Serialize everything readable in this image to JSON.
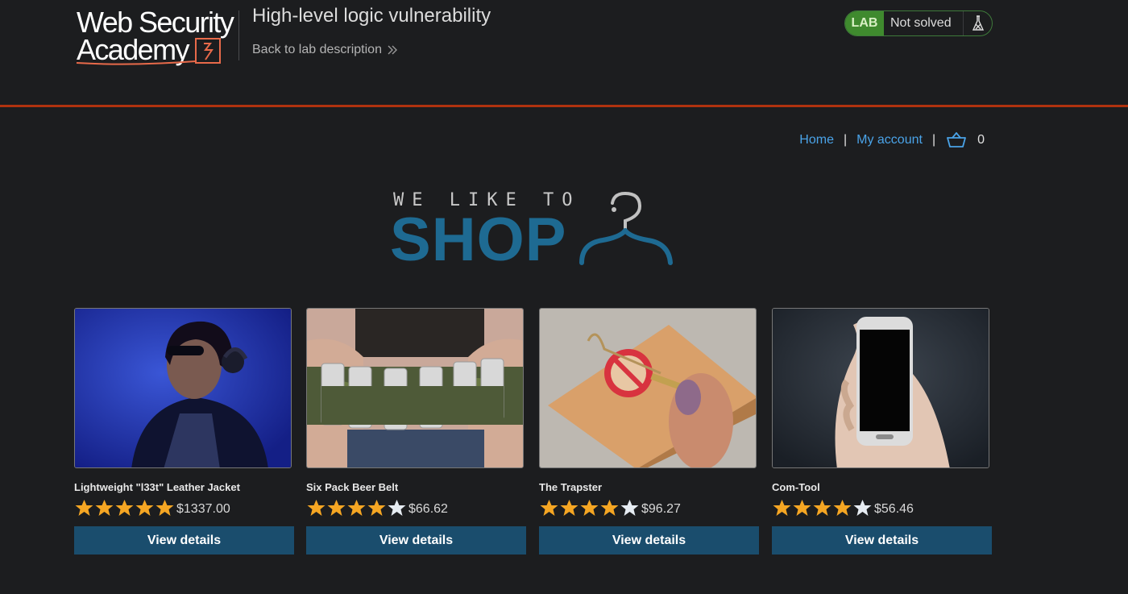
{
  "header": {
    "logo_line1": "Web Security",
    "logo_line2": "Academy",
    "lab_title": "High-level logic vulnerability",
    "back_link": "Back to lab description",
    "lab_badge": "LAB",
    "lab_status": "Not solved"
  },
  "nav": {
    "home": "Home",
    "account": "My account",
    "separator": "|",
    "cart_count": "0"
  },
  "banner": {
    "tagline": "WE LIKE TO",
    "headline": "SHOP"
  },
  "products": [
    {
      "name": "Lightweight \"l33t\" Leather Jacket",
      "rating": 5,
      "price": "$1337.00",
      "button": "View details"
    },
    {
      "name": "Six Pack Beer Belt",
      "rating": 4,
      "price": "$66.62",
      "button": "View details"
    },
    {
      "name": "The Trapster",
      "rating": 4,
      "price": "$96.27",
      "button": "View details"
    },
    {
      "name": "Com-Tool",
      "rating": 4,
      "price": "$56.46",
      "button": "View details"
    }
  ],
  "colors": {
    "background": "#1c1d1f",
    "accent_orange": "#b0320f",
    "link_blue": "#4aa3e8",
    "button": "#1a4d6d",
    "star_filled": "#f5a623",
    "star_empty": "#e6ecf2",
    "lab_green": "#3f8a2e"
  },
  "icons": [
    "double-chevron-right-icon",
    "flask-icon",
    "basket-icon",
    "hanger-icon",
    "star-icon"
  ]
}
